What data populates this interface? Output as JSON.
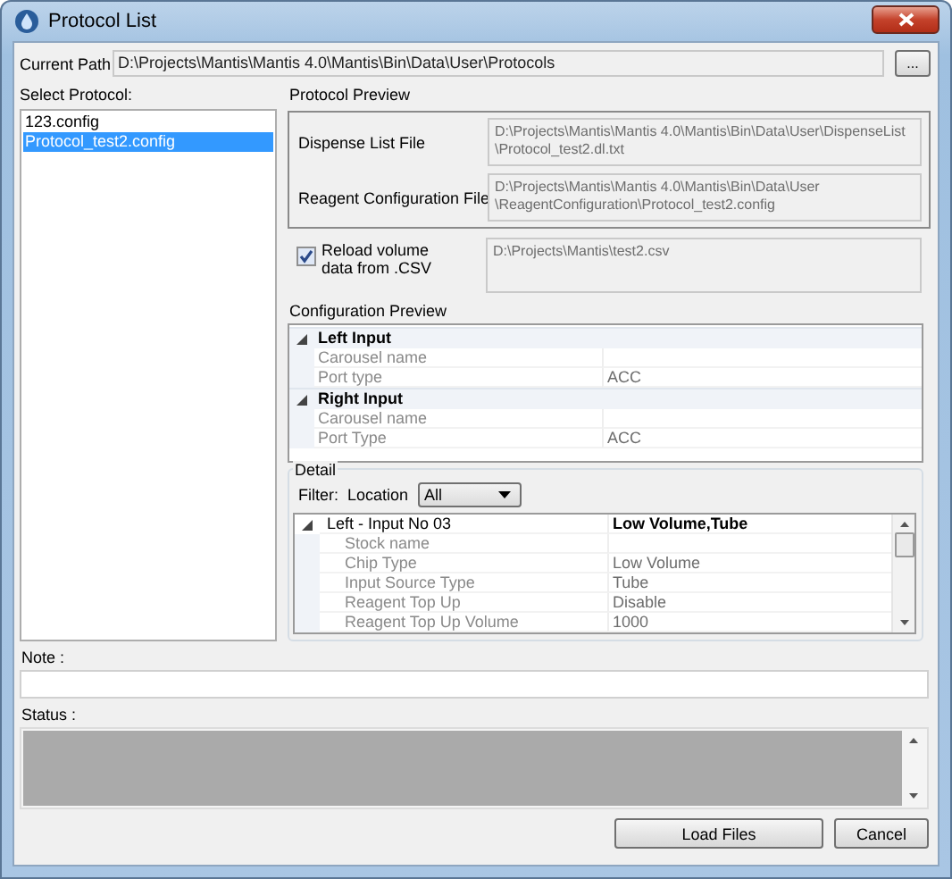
{
  "window": {
    "title": "Protocol List"
  },
  "current_path": {
    "label": "Current Path",
    "value": "D:\\Projects\\Mantis\\Mantis 4.0\\Mantis\\Bin\\Data\\User\\Protocols",
    "browse_button": "..."
  },
  "protocol_list": {
    "label": "Select Protocol:",
    "items": [
      {
        "name": "123.config",
        "selected": false
      },
      {
        "name": "Protocol_test2.config",
        "selected": true
      }
    ]
  },
  "protocol_preview": {
    "title": "Protocol Preview",
    "files": [
      {
        "label": "Dispense List File",
        "lines": [
          "D:\\Projects\\Mantis\\Mantis 4.0\\Mantis\\Bin\\Data\\User\\DispenseList",
          "\\Protocol_test2.dl.txt"
        ]
      },
      {
        "label": "Reagent Configuration File",
        "lines": [
          "D:\\Projects\\Mantis\\Mantis 4.0\\Mantis\\Bin\\Data\\User",
          "\\ReagentConfiguration\\Protocol_test2.config"
        ]
      }
    ]
  },
  "reload": {
    "label": "Reload volume data from .CSV",
    "checked": true,
    "value": "D:\\Projects\\Mantis\\test2.csv"
  },
  "configuration_preview": {
    "title": "Configuration Preview",
    "categories": [
      {
        "name": "Left Input",
        "expanded": true,
        "properties": [
          {
            "name": "Carousel name"
          },
          {
            "name": "Port type",
            "value": "ACC"
          }
        ]
      },
      {
        "name": "Right Input",
        "expanded": true,
        "properties": [
          {
            "name": "Carousel name"
          },
          {
            "name": "Port Type",
            "value": "ACC"
          }
        ]
      }
    ]
  },
  "detail": {
    "title": "Detail",
    "filter_label": "Filter:",
    "location_label": "Location",
    "location_value": "All",
    "categories": [
      {
        "name": "Left - Input No 03",
        "value": "Low Volume,Tube",
        "expanded": true,
        "properties": [
          {
            "name": "Stock name"
          },
          {
            "name": "Chip Type",
            "value": "Low Volume"
          },
          {
            "name": "Input Source Type",
            "value": "Tube"
          },
          {
            "name": "Reagent Top Up",
            "value": "Disable"
          },
          {
            "name": "Reagent Top Up Volume",
            "value": "1000"
          }
        ]
      }
    ]
  },
  "note": {
    "label": "Note :"
  },
  "status": {
    "label": "Status :"
  },
  "buttons": [
    {
      "label": "Load Files"
    },
    {
      "label": "Cancel"
    }
  ]
}
